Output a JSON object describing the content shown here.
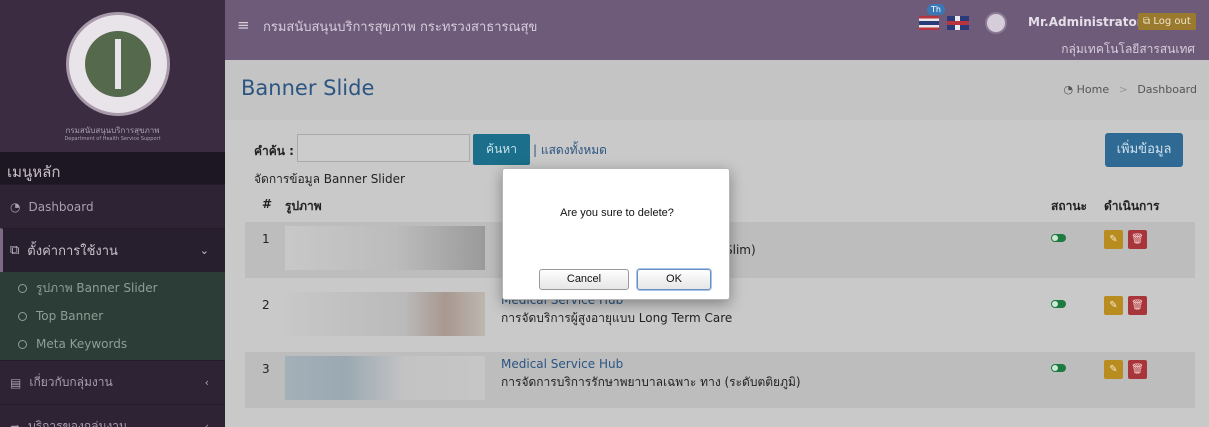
{
  "sidebar": {
    "org_name": "กรมสนับสนุนบริการสุขภาพ",
    "org_name_en": "Department of Health Service Support",
    "menu_heading": "เมนูหลัก",
    "items": [
      {
        "label": "Dashboard",
        "icon": "dashboard-icon"
      },
      {
        "label": "ตั้งค่าการใช้งาน",
        "icon": "settings-copy-icon",
        "caret": "⌄"
      },
      {
        "label": "เกี่ยวกับกลุ่มงาน",
        "icon": "book-icon",
        "caret": "‹"
      },
      {
        "label": "บริการของกลุ่มงาน",
        "icon": "share-icon",
        "caret": "‹"
      }
    ],
    "sub_items": [
      {
        "label": "รูปภาพ Banner Slider"
      },
      {
        "label": "Top Banner"
      },
      {
        "label": "Meta Keywords"
      }
    ]
  },
  "topbar": {
    "site_title": "กรมสนับสนุนบริการสุขภาพ กระทรวงสาธารณสุข",
    "lang_badge": "Th",
    "user_name": "Mr.Administrator",
    "logout_label": "Log out",
    "group_name": "กลุ่มเทคโนโลยีสารสนเทศ"
  },
  "header": {
    "page_title": "Banner Slide",
    "breadcrumb": [
      "Home",
      "Dashboard"
    ]
  },
  "search": {
    "label": "คำค้น :",
    "value": "",
    "button_label": "ค้นหา",
    "show_all_label": "| แสดงทั้งหมด"
  },
  "add_button_label": "เพิ่มข้อมูล",
  "section_caption": "จัดการข้อมูล Banner Slider",
  "table": {
    "columns": [
      "#",
      "รูปภาพ",
      "สถานะ",
      "ดำเนินการ"
    ],
    "rows": [
      {
        "num": "1",
        "title": "",
        "desc": "Slim)"
      },
      {
        "num": "2",
        "title": "Medical Service Hub",
        "desc": "การจัดบริการผู้สูงอายุแบบ Long Term Care"
      },
      {
        "num": "3",
        "title": "Medical Service Hub",
        "desc": "การจัดการบริการรักษาพยาบาลเฉพาะ ทาง (ระดับตติยภูมิ)"
      }
    ]
  },
  "dialog": {
    "message": "Are you sure to delete?",
    "cancel_label": "Cancel",
    "ok_label": "OK"
  },
  "colors": {
    "topbar": "#6e5a79",
    "sidebar": "#2e2334",
    "link": "#2b5582",
    "search_button": "#1b6f8a",
    "add_button": "#2e6a94",
    "edit_button": "#b88c1e",
    "delete_button": "#a8353a",
    "status_on": "#1e7b3f"
  }
}
